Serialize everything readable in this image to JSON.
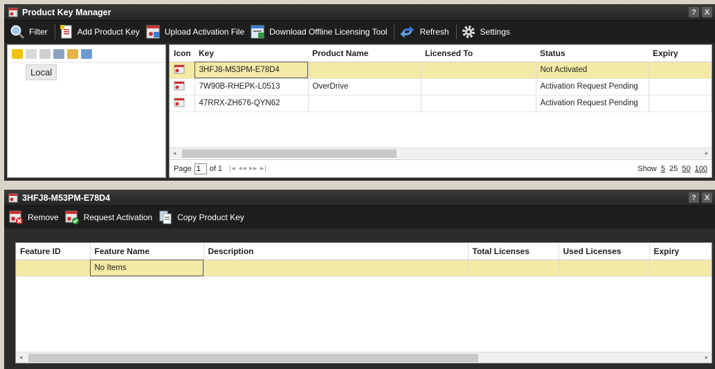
{
  "top_window": {
    "title": "Product Key Manager",
    "help": "?",
    "close": "X"
  },
  "toolbar": {
    "filter": "Filter",
    "add_key": "Add Product Key",
    "upload": "Upload Activation File",
    "download": "Download Offline Licensing Tool",
    "refresh": "Refresh",
    "settings": "Settings"
  },
  "tree": {
    "node": "Local"
  },
  "keys_grid": {
    "columns": [
      "Icon",
      "Key",
      "Product Name",
      "Licensed To",
      "Status",
      "Expiry"
    ],
    "rows": [
      {
        "key": "3HFJ8-M53PM-E78D4",
        "product": "",
        "licensed_to": "",
        "status": "Not Activated",
        "expiry": ""
      },
      {
        "key": "7W90B-RHEPK-L0513",
        "product": "OverDrive",
        "licensed_to": "",
        "status": "Activation Request Pending",
        "expiry": ""
      },
      {
        "key": "47RRX-ZH676-QYN62",
        "product": "",
        "licensed_to": "",
        "status": "Activation Request Pending",
        "expiry": ""
      }
    ]
  },
  "pager": {
    "page_label": "Page",
    "page_value": "1",
    "of_label": "of 1",
    "nav": "|◂ ◂◂ ▸▸ ▸|",
    "show_label": "Show",
    "sizes": [
      "5",
      "25",
      "50",
      "100"
    ]
  },
  "detail_window": {
    "title": "3HFJ8-M53PM-E78D4",
    "help": "?",
    "close": "X"
  },
  "detail_toolbar": {
    "remove": "Remove",
    "request": "Request Activation",
    "copy": "Copy Product Key"
  },
  "features_grid": {
    "columns": [
      "Feature ID",
      "Feature Name",
      "Description",
      "Total Licenses",
      "Used Licenses",
      "Expiry"
    ],
    "empty_text": "No Items"
  },
  "colors": {
    "selected_row": "#f3eaa6",
    "titlebar": "#2b2b2b"
  }
}
